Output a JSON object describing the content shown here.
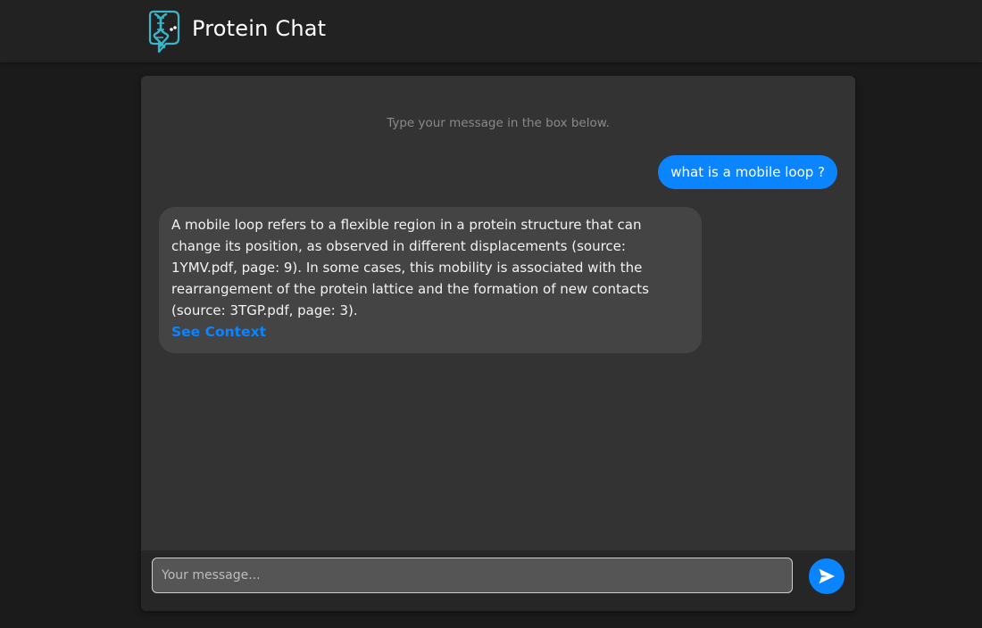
{
  "header": {
    "app_title": "Protein Chat",
    "logo_icon": "dna-chat-logo-icon"
  },
  "chat": {
    "hint": "Type your message in the box below.",
    "messages": [
      {
        "role": "user",
        "text": "what is a mobile loop ?"
      },
      {
        "role": "assistant",
        "text": "A mobile loop refers to a flexible region in a protein structure that can change its position, as observed in different displacements (source: 1YMV.pdf, page: 9). In some cases, this mobility is associated with the rearrangement of the protein lattice and the formation of new contacts (source: 3TGP.pdf, page: 3).",
        "link_label": "See Context"
      }
    ]
  },
  "composer": {
    "placeholder": "Your message...",
    "value": "",
    "send_icon": "send-icon"
  },
  "colors": {
    "accent": "#0b84ff",
    "page_background": "#1b1b1b",
    "header_background": "#222222",
    "card_background": "#333333",
    "assistant_bubble": "#444444",
    "logo_teal": "#39b6c9"
  }
}
